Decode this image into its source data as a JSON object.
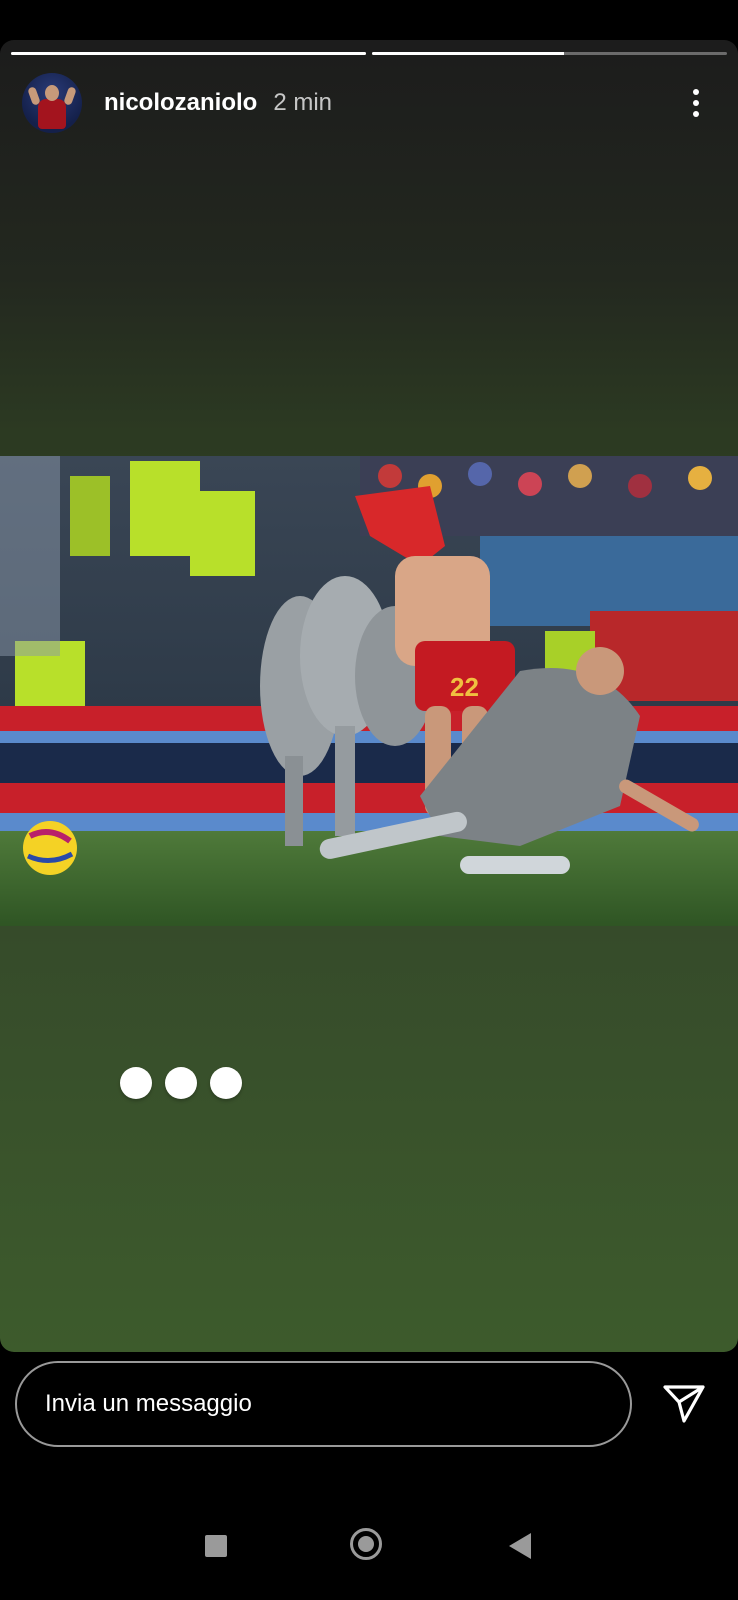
{
  "story": {
    "progress": [
      1.0,
      0.54
    ],
    "username": "nicolozaniolo",
    "time_ago": "2 min",
    "more_icon": "more-vertical-icon",
    "photo_jersey_number": "22"
  },
  "reply": {
    "placeholder": "Invia un messaggio",
    "send_icon": "send-paper-plane-icon"
  },
  "system_nav": {
    "recents_icon": "square-icon",
    "home_icon": "circle-icon",
    "back_icon": "triangle-back-icon"
  }
}
